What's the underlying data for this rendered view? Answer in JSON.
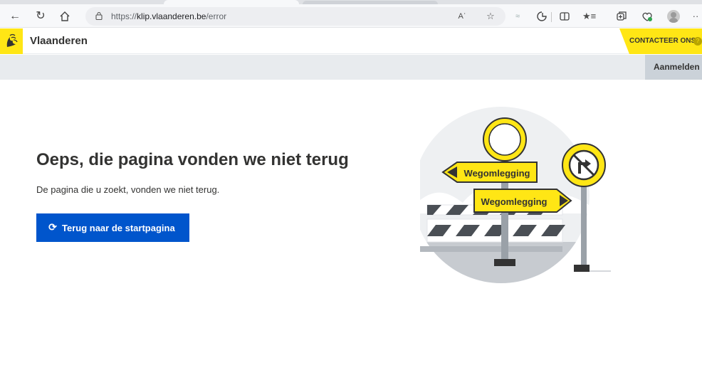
{
  "browser": {
    "url_prefix": "https://",
    "url_domain": "klip.vlaanderen.be",
    "url_path": "/error",
    "icons": [
      "back-icon",
      "refresh-icon",
      "home-icon",
      "lock-icon",
      "read-aloud-icon",
      "favorite-icon",
      "tracking-icon",
      "extensions-icon",
      "split-screen-icon",
      "favorites-list-icon",
      "collections-icon",
      "health-icon",
      "profile-icon",
      "more-icon"
    ]
  },
  "header": {
    "brand": "Vlaanderen",
    "contact_label": "CONTACTEER ONS",
    "contact_badge": "?"
  },
  "subbar": {
    "login_label": "Aanmelden"
  },
  "main": {
    "title": "Oeps, die pagina vonden we niet terug",
    "subtitle": "De pagina die u zoekt, vonden we niet terug.",
    "cta_label": "Terug naar de startpagina",
    "cta_icon": "refresh-icon"
  },
  "illustration": {
    "sign_top": "Wegomlegging",
    "sign_bottom": "Wegomlegging"
  },
  "colors": {
    "brand_yellow": "#ffe615",
    "primary_blue": "#0055cc",
    "text": "#333332"
  }
}
